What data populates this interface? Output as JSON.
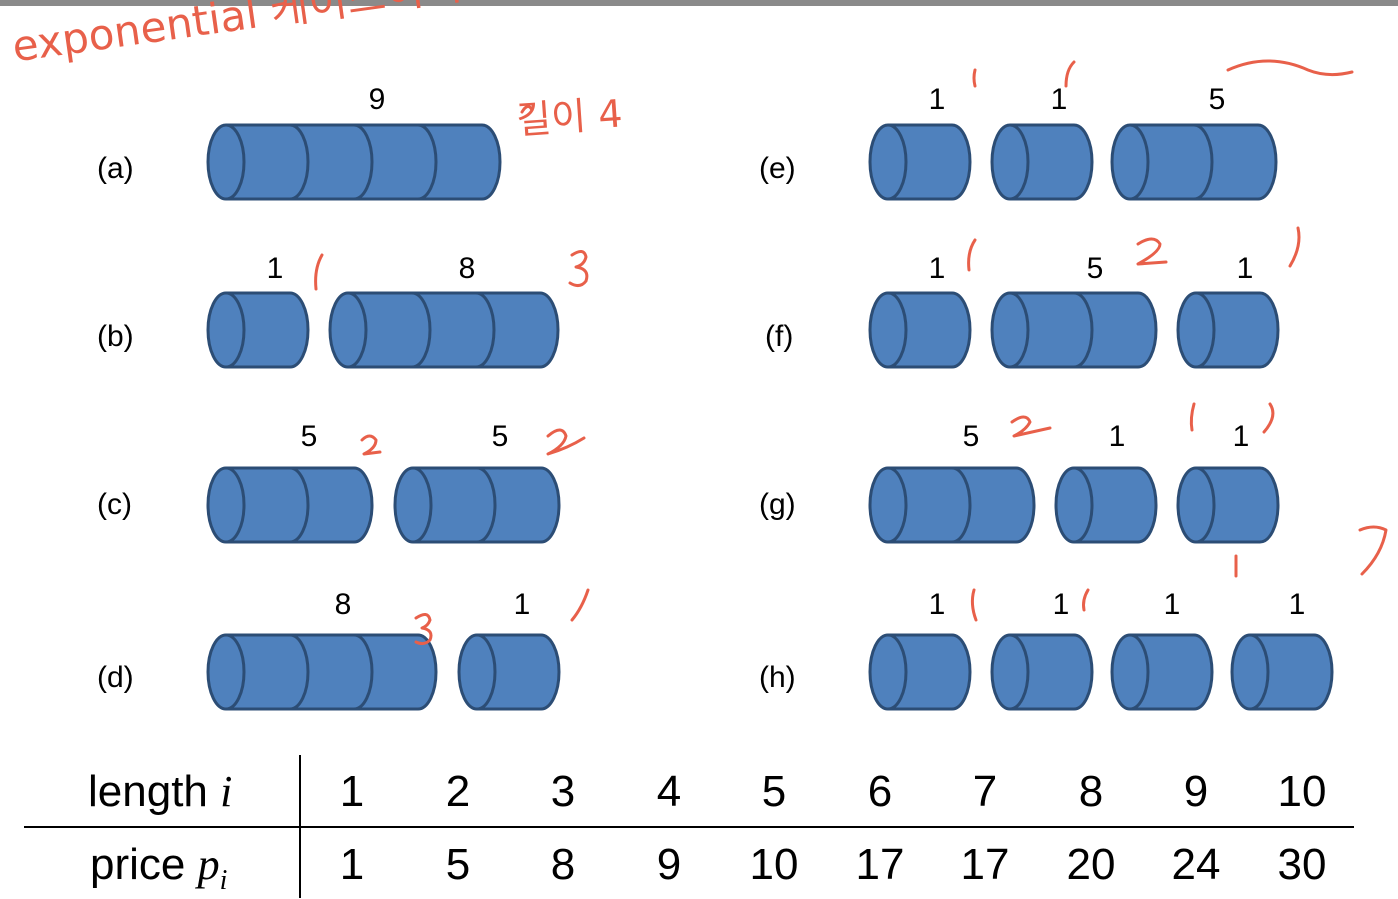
{
  "panels": [
    {
      "label": "(a)",
      "pieces": [
        "9"
      ]
    },
    {
      "label": "(b)",
      "pieces": [
        "1",
        "8"
      ]
    },
    {
      "label": "(c)",
      "pieces": [
        "5",
        "5"
      ]
    },
    {
      "label": "(d)",
      "pieces": [
        "8",
        "1"
      ]
    },
    {
      "label": "(e)",
      "pieces": [
        "1",
        "1",
        "5"
      ]
    },
    {
      "label": "(f)",
      "pieces": [
        "1",
        "5",
        "1"
      ]
    },
    {
      "label": "(g)",
      "pieces": [
        "5",
        "1",
        "1"
      ]
    },
    {
      "label": "(h)",
      "pieces": [
        "1",
        "1",
        "1",
        "1"
      ]
    }
  ],
  "table": {
    "length_label": "length",
    "length_var": "i",
    "price_label": "price",
    "price_var": "p",
    "price_sub": "i",
    "lengths": [
      "1",
      "2",
      "3",
      "4",
      "5",
      "6",
      "7",
      "8",
      "9",
      "10"
    ],
    "prices": [
      "1",
      "5",
      "8",
      "9",
      "10",
      "17",
      "17",
      "20",
      "24",
      "30"
    ]
  },
  "handwritten": {
    "title_note": "exponential 케이스이지만 너무게 접근한다",
    "sub_note": "길이 4"
  },
  "colors": {
    "rod_fill": "#4f81bd",
    "rod_stroke": "#2c4d75",
    "ink": "#e8604a"
  }
}
